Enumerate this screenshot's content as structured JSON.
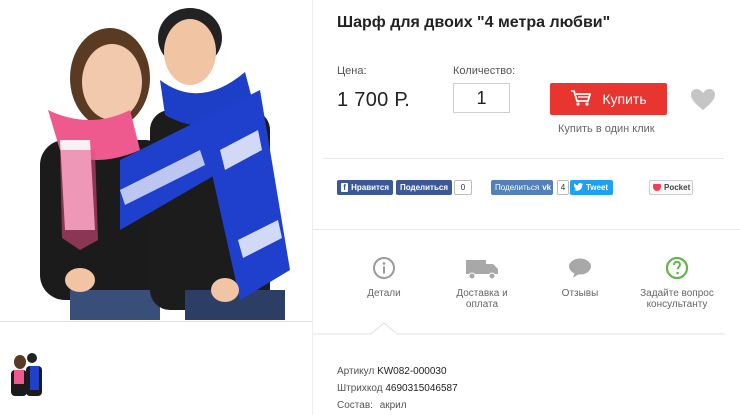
{
  "product": {
    "title": "Шарф для двоих \"4 метра любви\"",
    "price_label": "Цена:",
    "price": "1 700 Р.",
    "qty_label": "Количество:",
    "qty_value": "1",
    "buy_label": "Купить",
    "one_click": "Купить в один клик"
  },
  "social": {
    "fb_like": "Нравится",
    "fb_share": "Поделиться",
    "fb_count": "0",
    "vk_share": "Поделиться",
    "vk_count": "4",
    "tweet": "Tweet",
    "pocket": "Pocket"
  },
  "tabs": [
    {
      "label": "Детали",
      "icon": "info-icon"
    },
    {
      "label": "Доставка и оплата",
      "icon": "truck-icon"
    },
    {
      "label": "Отзывы",
      "icon": "chat-bubble-icon"
    },
    {
      "label": "Задайте вопрос консультанту",
      "icon": "question-icon"
    }
  ],
  "specs": {
    "sku_label": "Артикул",
    "sku": "KW082-000030",
    "barcode_label": "Штрихкод",
    "barcode": "4690315046587",
    "material_label": "Состав:",
    "material": "акрил"
  },
  "colors": {
    "buy": "#e8352f",
    "facebook": "#3b5998",
    "vk": "#5181b8",
    "twitter": "#1da1f2",
    "pocket_red": "#ef4056",
    "question_green": "#62b548"
  }
}
